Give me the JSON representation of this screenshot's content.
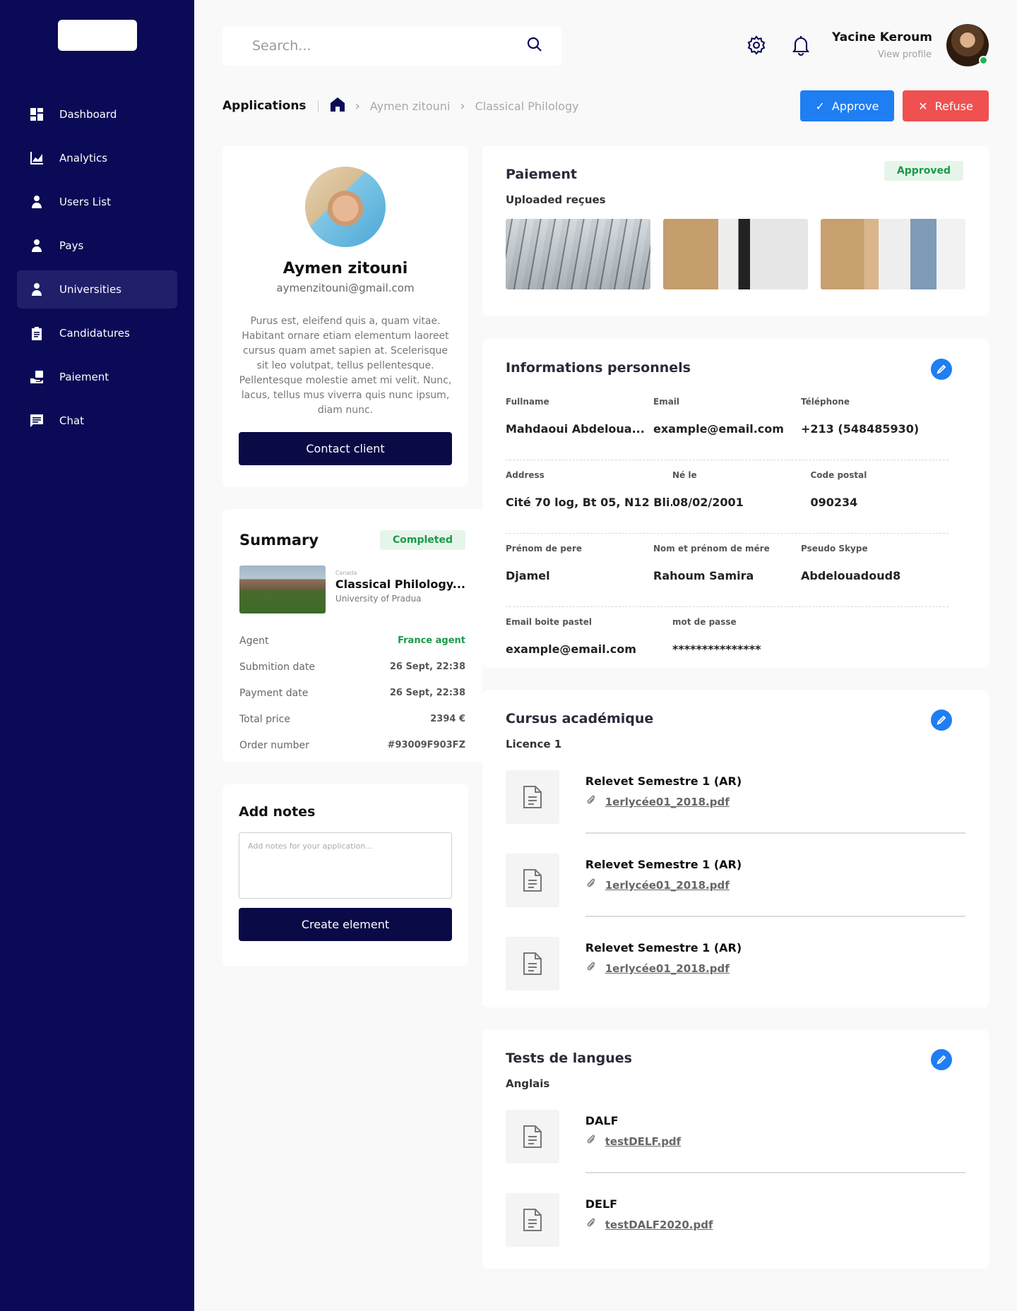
{
  "sidebar": {
    "items": [
      {
        "label": "Dashboard",
        "icon": "dashboard-icon"
      },
      {
        "label": "Analytics",
        "icon": "analytics-icon"
      },
      {
        "label": "Users List",
        "icon": "user-icon"
      },
      {
        "label": "Pays",
        "icon": "user-icon"
      },
      {
        "label": "Universities",
        "icon": "user-icon",
        "active": true
      },
      {
        "label": "Candidatures",
        "icon": "clipboard-icon"
      },
      {
        "label": "Paiement",
        "icon": "payment-icon"
      },
      {
        "label": "Chat",
        "icon": "chat-icon"
      }
    ]
  },
  "header": {
    "search_placeholder": "Search...",
    "user_name": "Yacine Keroum",
    "user_link": "View profile"
  },
  "breadcrumb": {
    "title": "Applications",
    "items": [
      "Aymen zitouni",
      "Classical Philology"
    ]
  },
  "actions": {
    "approve": "Approve",
    "refuse": "Refuse"
  },
  "profile": {
    "name": "Aymen zitouni",
    "email": "aymenzitouni@gmail.com",
    "bio": "Purus est, eleifend quis a, quam vitae. Habitant ornare etiam elementum laoreet cursus quam amet sapien at. Scelerisque sit leo volutpat, tellus pellentesque. Pellentesque molestie amet mi velit. Nunc, lacus, tellus mus viverra quis nunc ipsum, diam nunc.",
    "contact_button": "Contact client"
  },
  "summary": {
    "title": "Summary",
    "status": "Completed",
    "university": {
      "country": "Canada",
      "program": "Classical Philology...",
      "name": "University of Pradua"
    },
    "rows": [
      {
        "key": "Agent",
        "value": "France agent"
      },
      {
        "key": "Submition date",
        "value": "26 Sept, 22:38"
      },
      {
        "key": "Payment date",
        "value": "26 Sept, 22:38"
      },
      {
        "key": "Total price",
        "value": "2394 €"
      },
      {
        "key": "Order number",
        "value": "#93009F903FZ"
      }
    ]
  },
  "notes": {
    "title": "Add notes",
    "placeholder": "Add notes for your application...",
    "button": "Create element"
  },
  "paiement": {
    "title": "Paiement",
    "status": "Approved",
    "subtitle": "Uploaded reçues"
  },
  "personal": {
    "title": "Informations personnels",
    "rows": [
      [
        {
          "label": "Fullname",
          "value": "Mahdaoui Abdeloua..."
        },
        {
          "label": "Email",
          "value": "example@email.com"
        },
        {
          "label": "Téléphone",
          "value": "+213 (548485930)"
        }
      ],
      [
        {
          "label": "Address",
          "value": "Cité 70 log, Bt 05, N12 Bli..."
        },
        {
          "label": "Né le",
          "value": "08/02/2001"
        },
        {
          "label": "Code postal",
          "value": "090234"
        }
      ],
      [
        {
          "label": "Prénom de pere",
          "value": "Djamel"
        },
        {
          "label": "Nom et prénom de mére",
          "value": "Rahoum Samira"
        },
        {
          "label": "Pseudo Skype",
          "value": "Abdelouadoud8"
        }
      ],
      [
        {
          "label": "Email boite pastel",
          "value": "example@email.com"
        },
        {
          "label": "mot de passe",
          "value": "***************"
        }
      ]
    ]
  },
  "cursus": {
    "title": "Cursus académique",
    "subtitle": "Licence 1",
    "docs": [
      {
        "title": "Relevet Semestre 1 (AR)",
        "file": "1erlycée01_2018.pdf"
      },
      {
        "title": "Relevet Semestre 1 (AR)",
        "file": "1erlycée01_2018.pdf"
      },
      {
        "title": "Relevet Semestre 1 (AR)",
        "file": "1erlycée01_2018.pdf"
      }
    ]
  },
  "langues": {
    "title": "Tests de langues",
    "subtitle": "Anglais",
    "docs": [
      {
        "title": "DALF",
        "file": "testDELF.pdf"
      },
      {
        "title": "DELF",
        "file": "testDALF2020.pdf"
      }
    ]
  }
}
